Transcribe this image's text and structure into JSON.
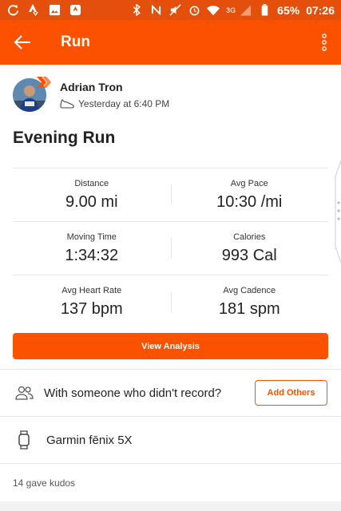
{
  "status_bar": {
    "battery": "65%",
    "time": "07:26",
    "network": "3G",
    "left_icons": [
      "sync-icon",
      "strava-logo-icon",
      "image-icon",
      "strava-badge-icon"
    ],
    "right_icons": [
      "bluetooth-icon",
      "nfc-icon",
      "mute-icon",
      "alarm-icon",
      "wifi-icon",
      "signal-icon",
      "battery-icon"
    ]
  },
  "app_bar": {
    "title": "Run",
    "color": "#fc5200"
  },
  "athlete": {
    "name": "Adrian Tron",
    "when": "Yesterday at 6:40 PM"
  },
  "activity": {
    "title": "Evening Run"
  },
  "stats": [
    [
      {
        "label": "Distance",
        "value": "9.00 mi"
      },
      {
        "label": "Avg Pace",
        "value": "10:30 /mi"
      }
    ],
    [
      {
        "label": "Moving Time",
        "value": "1:34:32"
      },
      {
        "label": "Calories",
        "value": "993 Cal"
      }
    ],
    [
      {
        "label": "Avg Heart Rate",
        "value": "137 bpm"
      },
      {
        "label": "Avg Cadence",
        "value": "181 spm"
      }
    ]
  ],
  "actions": {
    "view_analysis": "View Analysis",
    "with_someone": "With someone who didn't record?",
    "add_others": "Add Others"
  },
  "device": {
    "name": "Garmin fēnix 5X"
  },
  "kudos": "14 gave kudos"
}
